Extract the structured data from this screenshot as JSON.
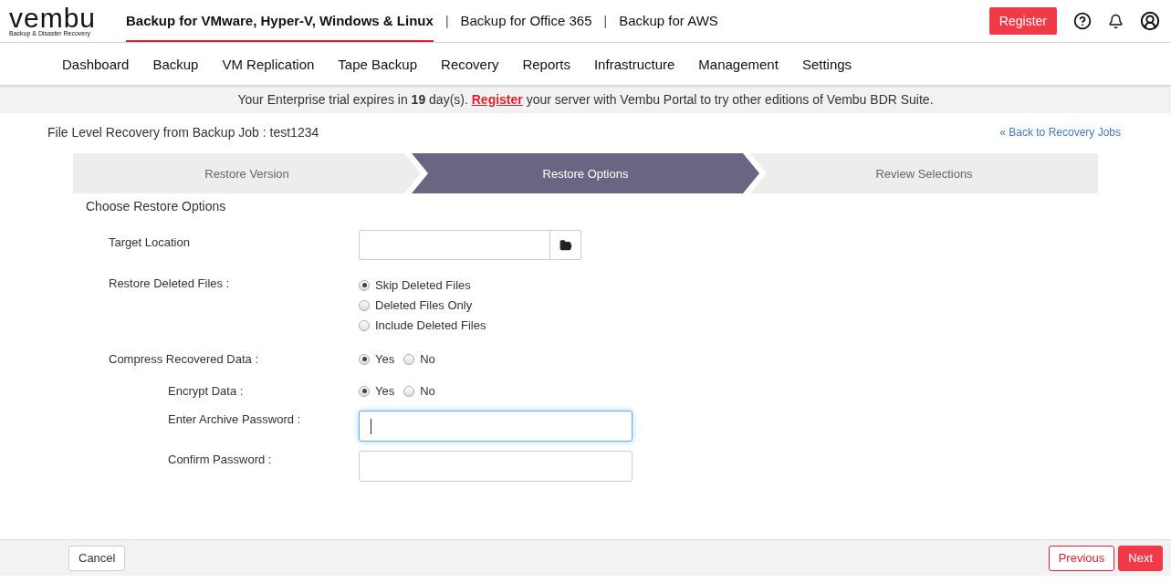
{
  "logo": {
    "name": "vembu",
    "tagline": "Backup & Disaster Recovery"
  },
  "products": [
    {
      "label": "Backup for VMware, Hyper-V, Windows & Linux",
      "selected": true
    },
    {
      "label": "Backup for Office 365",
      "selected": false,
      "separator": "|"
    },
    {
      "label": "Backup for AWS",
      "selected": false,
      "separator": "|"
    }
  ],
  "header_actions": {
    "register": "Register"
  },
  "nav": [
    {
      "label": "Dashboard"
    },
    {
      "label": "Backup"
    },
    {
      "label": "VM Replication"
    },
    {
      "label": "Tape Backup"
    },
    {
      "label": "Recovery"
    },
    {
      "label": "Reports"
    },
    {
      "label": "Infrastructure"
    },
    {
      "label": "Management"
    },
    {
      "label": "Settings"
    }
  ],
  "banner": {
    "before": "Your Enterprise trial expires in **19** day(s).",
    "link": "Register",
    "after": "your server with Vembu Portal to try other editions of Vembu BDR Suite."
  },
  "page_title": "File Level Recovery from Backup Job : test1234",
  "back_link": "« Back to Recovery Jobs",
  "steps": [
    {
      "label": "Restore Version",
      "selected": false
    },
    {
      "label": "Restore Options",
      "selected": true
    },
    {
      "label": "Review Selections",
      "selected": false
    }
  ],
  "section_title": "Choose Restore Options",
  "fields": [
    {
      "kind": "path",
      "label": "Target Location"
    },
    {
      "kind": "radio_list",
      "label": "Restore Deleted Files :",
      "options": [
        {
          "label": "Skip Deleted Files",
          "selected": true
        },
        {
          "label": "Deleted Files Only",
          "selected": false
        },
        {
          "label": "Include Deleted Files",
          "selected": false
        }
      ]
    },
    {
      "kind": "radio_inline",
      "label": "Compress Recovered Data :",
      "options": [
        {
          "label": "Yes",
          "selected": true
        },
        {
          "label": "No",
          "selected": false
        }
      ],
      "children": [
        {
          "kind": "radio_inline",
          "label": "Encrypt Data :",
          "options": [
            {
              "label": "Yes",
              "selected": true
            },
            {
              "label": "No",
              "selected": false
            }
          ]
        },
        {
          "kind": "password",
          "label": "Enter Archive Password :",
          "focused": true
        },
        {
          "kind": "password",
          "label": "Confirm Password :",
          "focused": false
        }
      ]
    }
  ],
  "footer": {
    "cancel": "Cancel",
    "previous": "Previous",
    "next": "Next"
  }
}
